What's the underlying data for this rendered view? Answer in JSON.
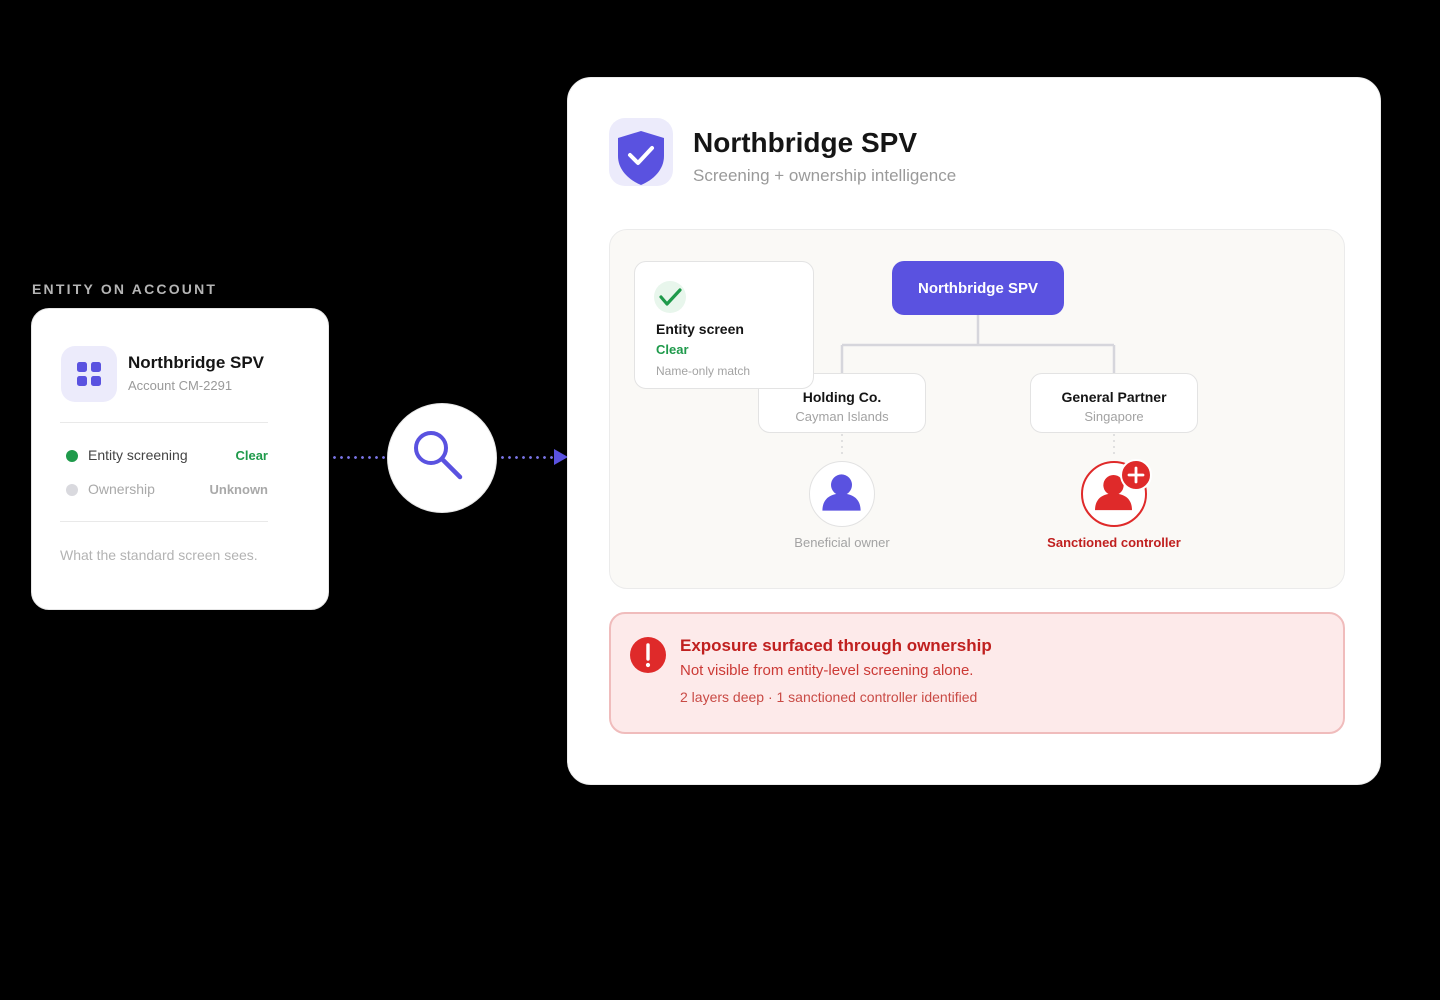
{
  "colors": {
    "accent": "#5a52e0",
    "clear": "#1f9a4b",
    "danger": "#df2a2a",
    "danger_text": "#c0201f",
    "muted": "#a3a3a3"
  },
  "left": {
    "section_label": "ENTITY ON ACCOUNT",
    "logo_icon": "grid-icon",
    "entity_name": "Northbridge SPV",
    "account": "Account CM-2291",
    "rows": [
      {
        "label": "Entity screening",
        "value": "Clear",
        "status_color": "#1f9a4b",
        "label_color": "#444444"
      },
      {
        "label": "Ownership",
        "value": "Unknown",
        "status_color": "#d9d9de",
        "label_color": "#a9a9a9"
      }
    ],
    "footnote": "What the standard screen sees."
  },
  "connector": {
    "icon": "search-icon"
  },
  "panel": {
    "icon": "shield-check-icon",
    "title": "Northbridge SPV",
    "subtitle": "Screening + ownership intelligence",
    "screen_card": {
      "icon": "check-icon",
      "title": "Entity screen",
      "status": "Clear",
      "note": "Name-only match"
    },
    "root": {
      "label": "Northbridge SPV"
    },
    "children": [
      {
        "name": "Holding Co.",
        "location": "Cayman Islands",
        "owner_label": "Beneficial owner",
        "owner_color": "#5a52e0"
      },
      {
        "name": "General Partner",
        "location": "Singapore",
        "owner_label": "Sanctioned controller",
        "owner_color": "#df2a2a"
      }
    ],
    "alert": {
      "icon": "alert-icon",
      "title": "Exposure surfaced through ownership",
      "subtitle": "Not visible from entity-level screening alone.",
      "meta": "2 layers deep · 1 sanctioned controller identified"
    }
  }
}
